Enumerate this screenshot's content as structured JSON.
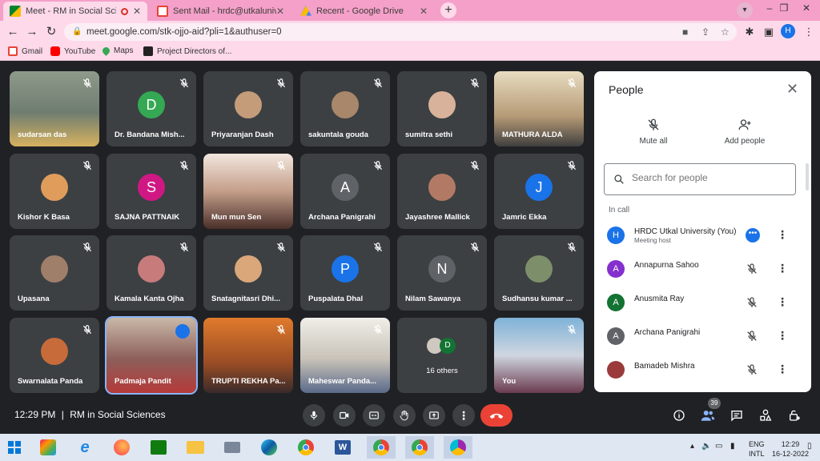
{
  "browser": {
    "tabs": [
      {
        "title": "Meet - RM in Social Sciences",
        "active": true,
        "recording": true
      },
      {
        "title": "Sent Mail - hrdc@utkaluniversity",
        "active": false
      },
      {
        "title": "Recent - Google Drive",
        "active": false
      }
    ],
    "url": "meet.google.com/stk-ojjo-aid?pli=1&authuser=0",
    "profile_initial": "H",
    "bookmarks": [
      "Gmail",
      "YouTube",
      "Maps",
      "Project Directors of..."
    ]
  },
  "meeting": {
    "tiles": [
      {
        "name": "sudarsan das",
        "kind": "video"
      },
      {
        "name": "Dr. Bandana Mish...",
        "kind": "initial",
        "initial": "D",
        "color": "#34a853"
      },
      {
        "name": "Priyaranjan Dash",
        "kind": "photo"
      },
      {
        "name": "sakuntala gouda",
        "kind": "photo"
      },
      {
        "name": "sumitra sethi",
        "kind": "photo"
      },
      {
        "name": "MATHURA ALDA",
        "kind": "video"
      },
      {
        "name": "Kishor K Basa",
        "kind": "photo"
      },
      {
        "name": "SAJNA PATTNAIK",
        "kind": "initial",
        "initial": "S",
        "color": "#d01884"
      },
      {
        "name": "Mun mun Sen",
        "kind": "video"
      },
      {
        "name": "Archana Panigrahi",
        "kind": "initial",
        "initial": "A",
        "color": "#5f6368"
      },
      {
        "name": "Jayashree Mallick",
        "kind": "photo"
      },
      {
        "name": "Jamric Ekka",
        "kind": "initial",
        "initial": "J",
        "color": "#1a73e8"
      },
      {
        "name": "Upasana",
        "kind": "photo"
      },
      {
        "name": "Kamala Kanta Ojha",
        "kind": "photo"
      },
      {
        "name": "Snatagnitasri Dhi...",
        "kind": "photo"
      },
      {
        "name": "Puspalata Dhal",
        "kind": "initial",
        "initial": "P",
        "color": "#1a73e8"
      },
      {
        "name": "Nilam Sawanya",
        "kind": "initial",
        "initial": "N",
        "color": "#5f6368"
      },
      {
        "name": "Sudhansu kumar ...",
        "kind": "photo"
      },
      {
        "name": "Swarnalata Panda",
        "kind": "photo"
      },
      {
        "name": "Padmaja Pandit",
        "kind": "video",
        "speaking": true
      },
      {
        "name": "TRUPTI REKHA Pa...",
        "kind": "video"
      },
      {
        "name": "Maheswar Panda...",
        "kind": "video"
      },
      {
        "name": "16 others",
        "kind": "others"
      },
      {
        "name": "You",
        "kind": "video"
      }
    ],
    "others_initial": "D",
    "clock": "12:29 PM",
    "divider": "|",
    "meeting_name": "RM in Social Sciences",
    "participant_count": "39"
  },
  "people_panel": {
    "title": "People",
    "mute_all": "Mute all",
    "add_people": "Add people",
    "search_placeholder": "Search for people",
    "section": "In call",
    "people": [
      {
        "name": "HRDC Utkal University (You)",
        "sub": "Meeting host",
        "initial": "H",
        "color": "#1a73e8",
        "host": true
      },
      {
        "name": "Annapurna Sahoo",
        "initial": "A",
        "color": "#8430ce"
      },
      {
        "name": "Anusmita Ray",
        "initial": "A",
        "color": "#137333"
      },
      {
        "name": "Archana Panigrahi",
        "initial": "A",
        "color": "#5f6368"
      },
      {
        "name": "Bamadeb Mishra",
        "initial": "",
        "color": "#9b3a3a"
      }
    ]
  },
  "taskbar": {
    "lang_top": "ENG",
    "lang_bottom": "INTL",
    "time": "12:29",
    "date": "16-12-2022"
  }
}
